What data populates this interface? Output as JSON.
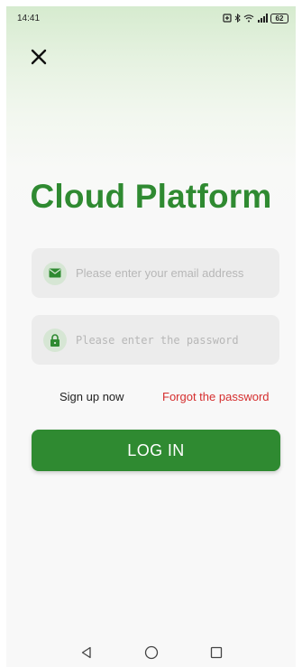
{
  "status_bar": {
    "time": "14:41",
    "indicators": "★ ʃ ¹¹.╲",
    "battery": "62"
  },
  "header": {
    "close_icon": "close-icon"
  },
  "app": {
    "title": "Cloud Platform",
    "brand_color": "#2f8a31"
  },
  "form": {
    "email": {
      "icon": "mail-icon",
      "value": "",
      "placeholder": "Please enter your email address"
    },
    "password": {
      "icon": "lock-icon",
      "value": "",
      "placeholder": "Please enter the password"
    },
    "signup_label": "Sign up now",
    "forgot_label": "Forgot the password",
    "forgot_color": "#d52e2e",
    "login_label": "LOG IN"
  },
  "nav": {
    "back_icon": "back-triangle-icon",
    "home_icon": "home-circle-icon",
    "recents_icon": "recents-square-icon"
  }
}
